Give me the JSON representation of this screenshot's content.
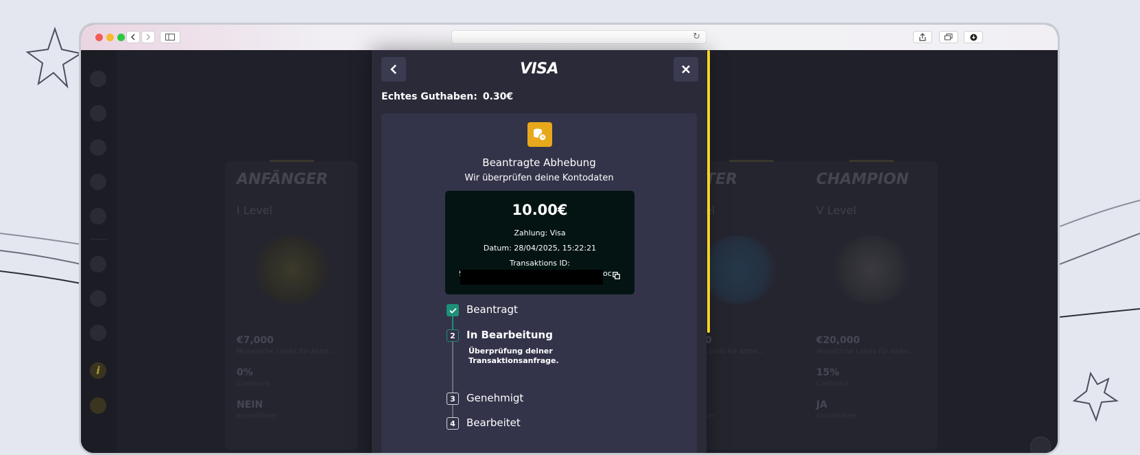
{
  "modal": {
    "brand": "VISA",
    "balance_label": "Echtes Guthaben:",
    "balance_value": "0.30€",
    "request_title": "Beantragte Abhebung",
    "request_subtitle": "Wir überprüfen deine Kontodaten",
    "receipt": {
      "amount": "10.00€",
      "payment": "Zahlung: Visa",
      "date": "Datum: 28/04/2025, 15:22:21",
      "txid_label": "Transaktions ID:",
      "txid_prefix": "9",
      "txid_suffix": "oc"
    },
    "steps": [
      {
        "number": "1",
        "label": "Beantragt",
        "state": "done"
      },
      {
        "number": "2",
        "label": "In Bearbeitung",
        "state": "active",
        "note": "Überprüfung deiner Transaktionsanfrage."
      },
      {
        "number": "3",
        "label": "Genehmigt",
        "state": "pending"
      },
      {
        "number": "4",
        "label": "Bearbeitet",
        "state": "pending"
      }
    ]
  },
  "background_cards": [
    {
      "title": "ANFÄNGER",
      "level": "I Level",
      "limit": "€7,000",
      "limit_label": "Monatliche Limits für Abhe...",
      "cashback": "0%",
      "cashback_label": "Cashback",
      "account": "NEIN",
      "account_label": "Kontoführer"
    },
    {
      "title": "TER",
      "level": "el",
      "limit": "0",
      "limit_label": "Limits für Abhe...",
      "cashback": "",
      "cashback_label": "",
      "account": "",
      "account_label": "ter"
    },
    {
      "title": "CHAMPION",
      "level": "V Level",
      "limit": "€20,000",
      "limit_label": "Monatliche Limits für Abhe...",
      "cashback": "15%",
      "cashback_label": "Cashback",
      "account": "JA",
      "account_label": "Kontoführer"
    }
  ],
  "icons": {
    "back": "chevron-left-icon",
    "close": "close-icon",
    "coin": "coins-clock-icon",
    "copy": "copy-icon",
    "check": "check-icon"
  },
  "colors": {
    "accent_yellow": "#f5d523",
    "coin_bg": "#e8a81c",
    "step_done": "#1e8f78",
    "modal_bg": "#2a2a39",
    "panel_bg": "#333449",
    "receipt_bg": "#031413"
  }
}
